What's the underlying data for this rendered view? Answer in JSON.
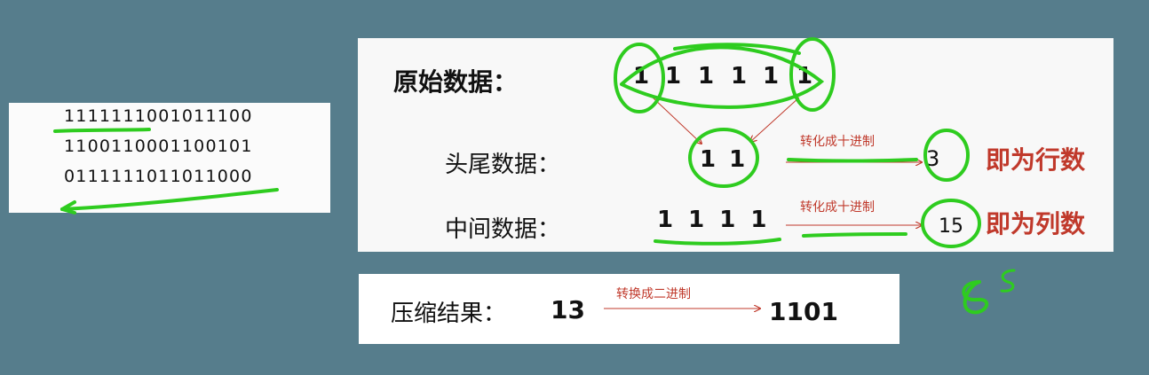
{
  "binary_lines": [
    "1111111001011100",
    "1100110001100101",
    "0111111011011000"
  ],
  "main": {
    "original_label": "原始数据：",
    "original_digits": [
      "1",
      "1",
      "1",
      "1",
      "1",
      "1"
    ],
    "head_tail_label": "头尾数据：",
    "head_tail_digits": "1 1",
    "middle_label": "中间数据：",
    "middle_digits": "1 1 1 1",
    "convert_label": "转化成十进制",
    "row_value": "3",
    "row_text": "即为行数",
    "col_value": "15",
    "col_text": "即为列数"
  },
  "result": {
    "label": "压缩结果：",
    "value": "13",
    "convert_label": "转换成二进制",
    "binary": "1101"
  },
  "handwritten_note": "85",
  "colors": {
    "background": "#567d8c",
    "accent_red": "#c0392b",
    "ink_green": "#2ecc1f"
  }
}
